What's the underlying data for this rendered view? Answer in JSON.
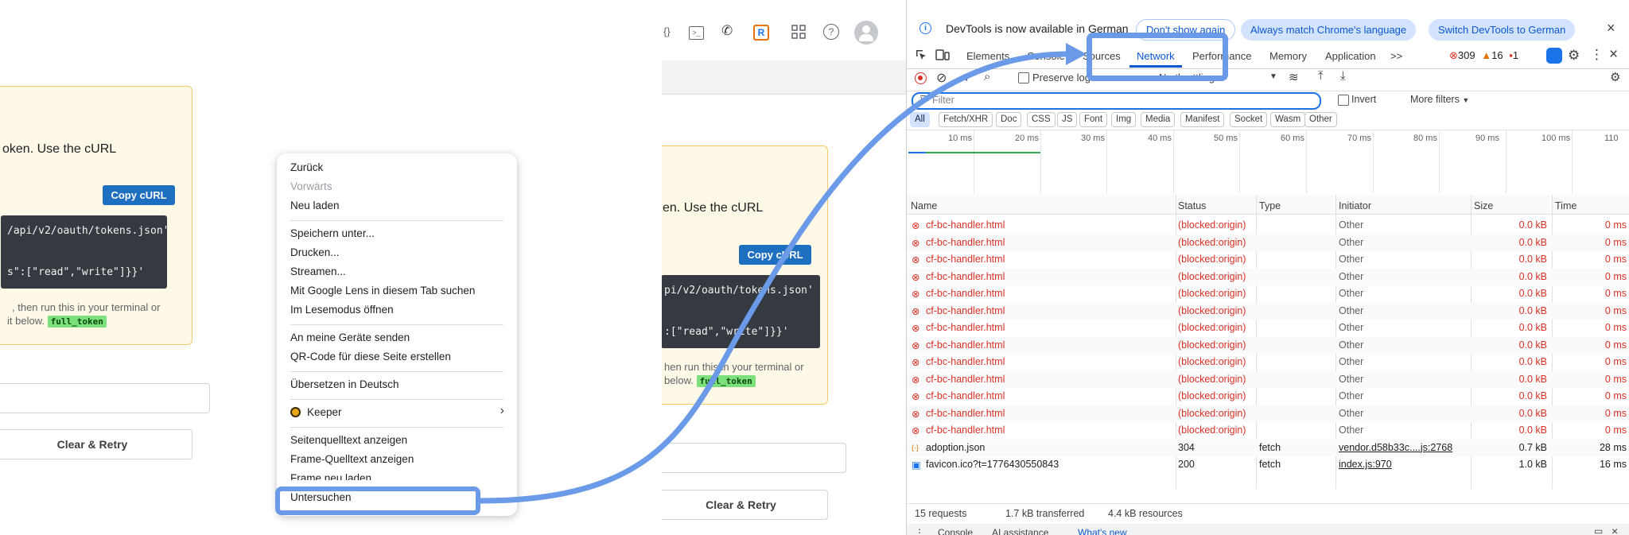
{
  "left": {
    "card_text": "oken. Use the cURL",
    "copy_button": "Copy cURL",
    "code_line1": "/api/v2/oauth/tokens.json'",
    "code_line2": "s\":[\"read\",\"write\"]}}'",
    "note_line1": ", then run this in your terminal or",
    "note_line2": "it below.",
    "token_label": "full_token",
    "clear_button": "Clear & Retry"
  },
  "context_menu": {
    "items": [
      {
        "label": "Zurück",
        "disabled": false
      },
      {
        "label": "Vorwärts",
        "disabled": true
      },
      {
        "label": "Neu laden",
        "disabled": false
      },
      {
        "label": "Speichern unter...",
        "disabled": false
      },
      {
        "label": "Drucken...",
        "disabled": false
      },
      {
        "label": "Streamen...",
        "disabled": false
      },
      {
        "label": "Mit Google Lens in diesem Tab suchen",
        "disabled": false
      },
      {
        "label": "Im Lesemodus öffnen",
        "disabled": false
      },
      {
        "label": "An meine Geräte senden",
        "disabled": false
      },
      {
        "label": "QR-Code für diese Seite erstellen",
        "disabled": false
      },
      {
        "label": "Übersetzen in Deutsch",
        "disabled": false
      },
      {
        "label": "Keeper",
        "disabled": false
      },
      {
        "label": "Seitenquelltext anzeigen",
        "disabled": false
      },
      {
        "label": "Frame-Quelltext anzeigen",
        "disabled": false
      },
      {
        "label": "Frame neu laden",
        "disabled": false
      },
      {
        "label": "Untersuchen",
        "disabled": false
      }
    ]
  },
  "middle": {
    "card_text": "en. Use the cURL",
    "copy_button": "Copy cURL",
    "code_line1": "pi/v2/oauth/tokens.json'",
    "code_line2": ":[\"read\",\"write\"]}}'",
    "note_line1": "hen run this in your terminal or",
    "note_line2": "below.",
    "token_label": "full_token",
    "clear_button": "Clear & Retry",
    "toolbar_icons": [
      "braces-icon",
      "terminal-icon",
      "phone-icon",
      "r-extension-icon",
      "apps-grid-icon",
      "help-icon",
      "avatar"
    ]
  },
  "devtools": {
    "banner": {
      "text": "DevTools is now available in German",
      "dont_show": "Don't show again",
      "always_match": "Always match Chrome's language",
      "switch": "Switch DevTools to German"
    },
    "tabs": [
      "Elements",
      "Console",
      "Sources",
      "Network",
      "Performance",
      "Memory",
      "Application"
    ],
    "more_tabs": ">>",
    "active_tab": "Network",
    "error_count": "309",
    "warning_count": "16",
    "issue_count": "1",
    "toolbar": {
      "preserve_log": "Preserve log",
      "throttling": "No throttling"
    },
    "filter_placeholder": "Filter",
    "invert": "Invert",
    "more_filters": "More filters",
    "type_filters": [
      "All",
      "Fetch/XHR",
      "Doc",
      "CSS",
      "JS",
      "Font",
      "Img",
      "Media",
      "Manifest",
      "Socket",
      "Wasm",
      "Other"
    ],
    "timeline_ticks": [
      "10 ms",
      "20 ms",
      "30 ms",
      "40 ms",
      "50 ms",
      "60 ms",
      "70 ms",
      "80 ms",
      "90 ms",
      "100 ms",
      "110"
    ],
    "columns": [
      "Name",
      "Status",
      "Type",
      "Initiator",
      "Size",
      "Time"
    ],
    "requests": [
      {
        "name": "cf-bc-handler.html",
        "status": "(blocked:origin)",
        "type": "",
        "initiator": "Other",
        "size": "0.0 kB",
        "time": "0 ms",
        "error": true
      },
      {
        "name": "cf-bc-handler.html",
        "status": "(blocked:origin)",
        "type": "",
        "initiator": "Other",
        "size": "0.0 kB",
        "time": "0 ms",
        "error": true
      },
      {
        "name": "cf-bc-handler.html",
        "status": "(blocked:origin)",
        "type": "",
        "initiator": "Other",
        "size": "0.0 kB",
        "time": "0 ms",
        "error": true
      },
      {
        "name": "cf-bc-handler.html",
        "status": "(blocked:origin)",
        "type": "",
        "initiator": "Other",
        "size": "0.0 kB",
        "time": "0 ms",
        "error": true
      },
      {
        "name": "cf-bc-handler.html",
        "status": "(blocked:origin)",
        "type": "",
        "initiator": "Other",
        "size": "0.0 kB",
        "time": "0 ms",
        "error": true
      },
      {
        "name": "cf-bc-handler.html",
        "status": "(blocked:origin)",
        "type": "",
        "initiator": "Other",
        "size": "0.0 kB",
        "time": "0 ms",
        "error": true
      },
      {
        "name": "cf-bc-handler.html",
        "status": "(blocked:origin)",
        "type": "",
        "initiator": "Other",
        "size": "0.0 kB",
        "time": "0 ms",
        "error": true
      },
      {
        "name": "cf-bc-handler.html",
        "status": "(blocked:origin)",
        "type": "",
        "initiator": "Other",
        "size": "0.0 kB",
        "time": "0 ms",
        "error": true
      },
      {
        "name": "cf-bc-handler.html",
        "status": "(blocked:origin)",
        "type": "",
        "initiator": "Other",
        "size": "0.0 kB",
        "time": "0 ms",
        "error": true
      },
      {
        "name": "cf-bc-handler.html",
        "status": "(blocked:origin)",
        "type": "",
        "initiator": "Other",
        "size": "0.0 kB",
        "time": "0 ms",
        "error": true
      },
      {
        "name": "cf-bc-handler.html",
        "status": "(blocked:origin)",
        "type": "",
        "initiator": "Other",
        "size": "0.0 kB",
        "time": "0 ms",
        "error": true
      },
      {
        "name": "cf-bc-handler.html",
        "status": "(blocked:origin)",
        "type": "",
        "initiator": "Other",
        "size": "0.0 kB",
        "time": "0 ms",
        "error": true
      },
      {
        "name": "cf-bc-handler.html",
        "status": "(blocked:origin)",
        "type": "",
        "initiator": "Other",
        "size": "0.0 kB",
        "time": "0 ms",
        "error": true
      },
      {
        "name": "adoption.json",
        "status": "304",
        "type": "fetch",
        "initiator": "vendor.d58b33c....js:2768",
        "size": "0.7 kB",
        "time": "28 ms",
        "error": false,
        "icon": "json"
      },
      {
        "name": "favicon.ico?t=1776430550843",
        "status": "200",
        "type": "fetch",
        "initiator": "index.js:970",
        "size": "1.0 kB",
        "time": "16 ms",
        "error": false,
        "icon": "image"
      }
    ],
    "summary": {
      "requests": "15 requests",
      "transferred": "1.7 kB transferred",
      "resources": "4.4 kB resources"
    },
    "drawer_tabs": [
      "Console",
      "AI assistance",
      "What's new"
    ]
  },
  "colors": {
    "highlight": "#6a9ae8",
    "error": "#d93025",
    "accent": "#0b57d0"
  }
}
